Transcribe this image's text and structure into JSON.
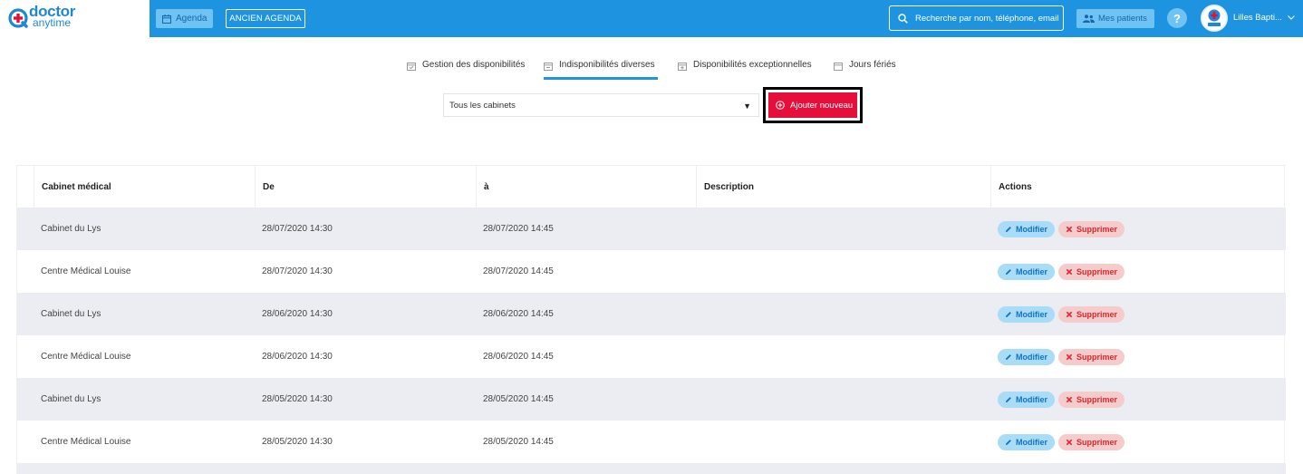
{
  "brand": {
    "line1": "doctor",
    "line2": "anytime",
    "color": "#1e88d8"
  },
  "topbar": {
    "color": "#1e93e0",
    "agenda_label": "Agenda",
    "ancien_label": "ANCIEN AGENDA",
    "search_placeholder": "Recherche par nom, téléphone, email",
    "patients_label": "Mes patients",
    "help_label": "?",
    "user_name": "Lilles Bapti..."
  },
  "tabs": [
    {
      "label": "Gestion des disponibilités",
      "active": false
    },
    {
      "label": "Indisponibilités diverses",
      "active": true
    },
    {
      "label": "Disponibilités exceptionnelles",
      "active": false
    },
    {
      "label": "Jours fériés",
      "active": false
    }
  ],
  "filter": {
    "selected": "Tous les cabinets"
  },
  "add_button": {
    "label": "Ajouter nouveau",
    "color": "#e60f3c"
  },
  "table": {
    "headers": [
      "Cabinet médical",
      "De",
      "à",
      "Description",
      "Actions"
    ],
    "rows": [
      {
        "cabinet": "Cabinet du Lys",
        "from": "28/07/2020 14:30",
        "to": "28/07/2020 14:45",
        "description": ""
      },
      {
        "cabinet": "Centre Médical Louise",
        "from": "28/07/2020 14:30",
        "to": "28/07/2020 14:45",
        "description": ""
      },
      {
        "cabinet": "Cabinet du Lys",
        "from": "28/06/2020 14:30",
        "to": "28/06/2020 14:45",
        "description": ""
      },
      {
        "cabinet": "Centre Médical Louise",
        "from": "28/06/2020 14:30",
        "to": "28/06/2020 14:45",
        "description": ""
      },
      {
        "cabinet": "Cabinet du Lys",
        "from": "28/05/2020 14:30",
        "to": "28/05/2020 14:45",
        "description": ""
      },
      {
        "cabinet": "Centre Médical Louise",
        "from": "28/05/2020 14:30",
        "to": "28/05/2020 14:45",
        "description": ""
      }
    ],
    "modify_label": "Modifier",
    "delete_label": "Supprimer"
  }
}
